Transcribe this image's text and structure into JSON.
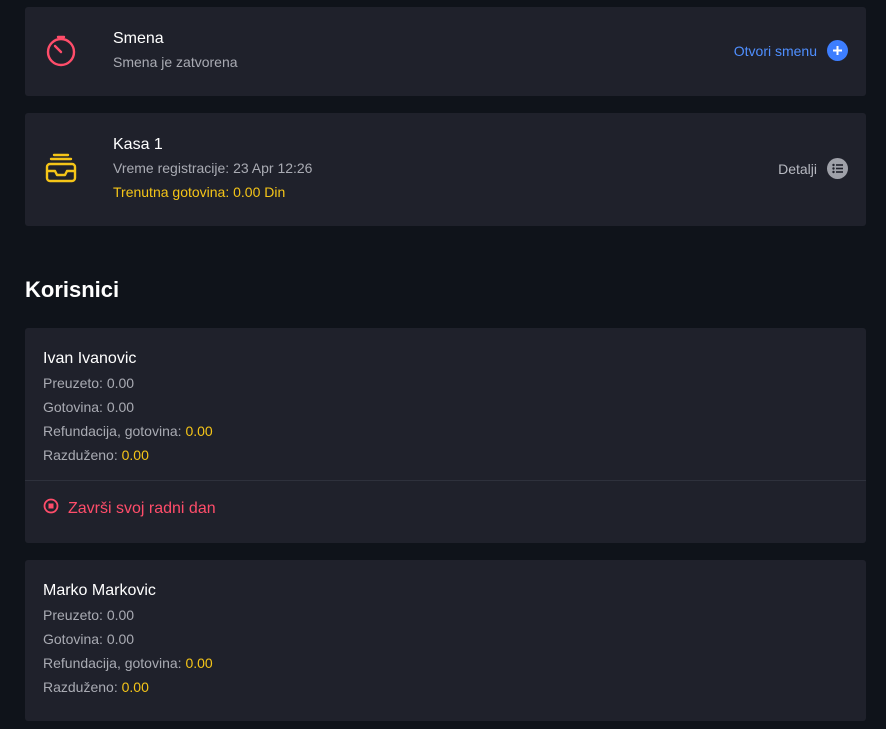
{
  "shift": {
    "title": "Smena",
    "status": "Smena je zatvorena",
    "action_label": "Otvori smenu",
    "icon": "timer-icon",
    "action_icon": "plus-circle-icon"
  },
  "register": {
    "title": "Kasa 1",
    "registration_label": "Vreme registracije: 23 Apr 12:26",
    "cash_label": "Trenutna gotovina: 0.00 Din",
    "action_label": "Detalji",
    "icon": "inbox-tray-icon",
    "action_icon": "list-circle-icon"
  },
  "users_section": {
    "title": "Korisnici"
  },
  "users": [
    {
      "name": "Ivan Ivanovic",
      "taken_label": "Preuzeto:",
      "taken_value": "0.00",
      "cash_label": "Gotovina:",
      "cash_value": "0.00",
      "refund_label": "Refundacija, gotovina:",
      "refund_value": "0.00",
      "settled_label": "Razduženo:",
      "settled_value": "0.00",
      "end_day_label": "Završi svoj radni dan"
    },
    {
      "name": "Marko Markovic",
      "taken_label": "Preuzeto:",
      "taken_value": "0.00",
      "cash_label": "Gotovina:",
      "cash_value": "0.00",
      "refund_label": "Refundacija, gotovina:",
      "refund_value": "0.00",
      "settled_label": "Razduženo:",
      "settled_value": "0.00"
    }
  ],
  "colors": {
    "background": "#0f131a",
    "card": "#1f212b",
    "accent_blue": "#3d7eff",
    "accent_red": "#ff4d6a",
    "accent_yellow": "#f5c518"
  }
}
